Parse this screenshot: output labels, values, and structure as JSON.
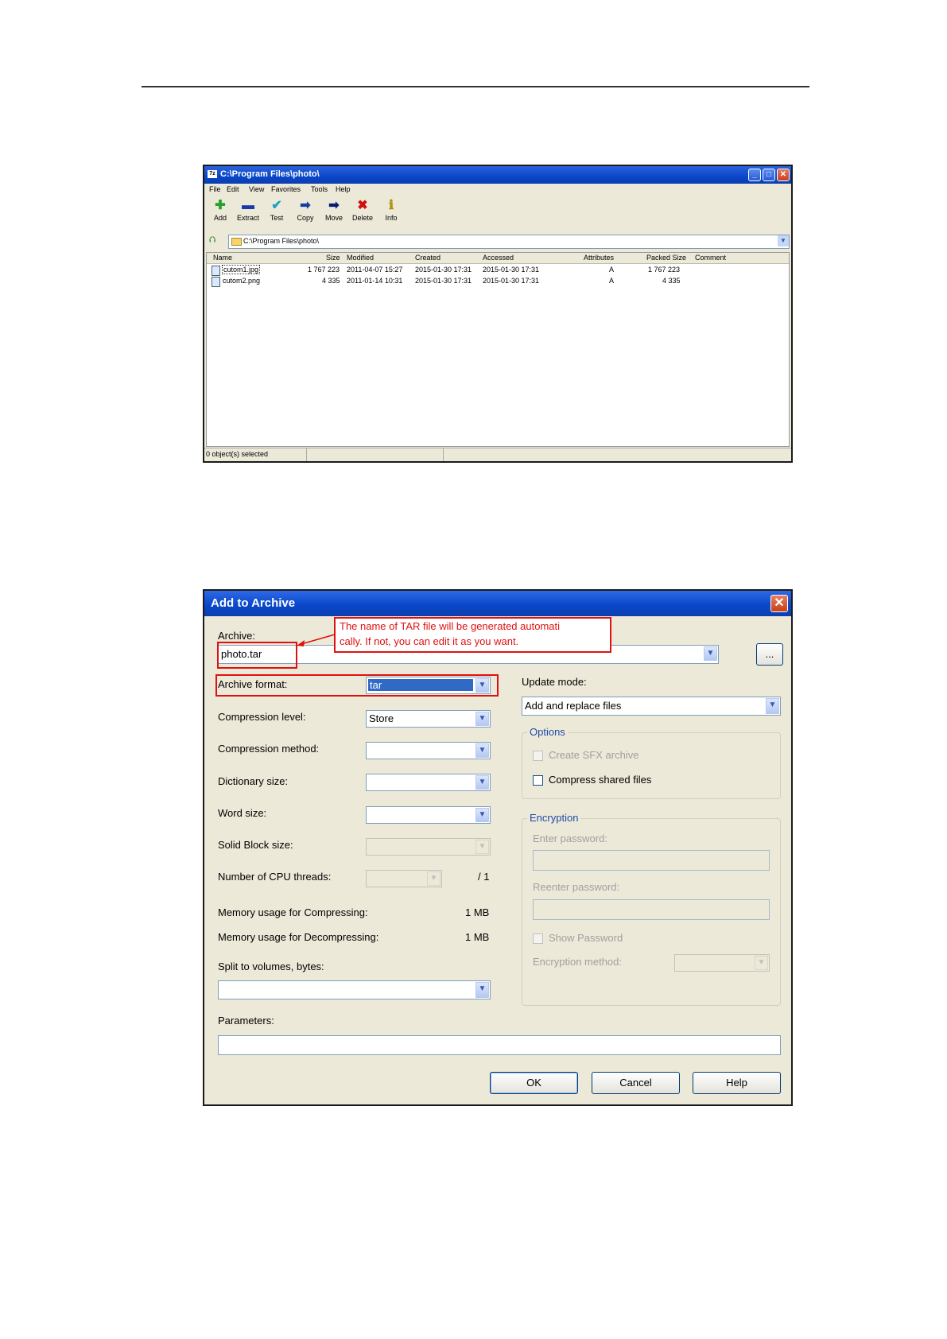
{
  "file_manager": {
    "title": "C:\\Program Files\\photo\\",
    "title_icon": "7z",
    "menu": [
      "File",
      "Edit",
      "View",
      "Favorites",
      "Tools",
      "Help"
    ],
    "toolbar": [
      {
        "label": "Add",
        "icon": "plus-icon",
        "glyph": "✚",
        "color": "#2aa02a"
      },
      {
        "label": "Extract",
        "icon": "minus-icon",
        "glyph": "▬",
        "color": "#1a3aa8"
      },
      {
        "label": "Test",
        "icon": "check-icon",
        "glyph": "✔",
        "color": "#18a0c8"
      },
      {
        "label": "Copy",
        "icon": "copy-arrow-icon",
        "glyph": "➡",
        "color": "#1a3aa8"
      },
      {
        "label": "Move",
        "icon": "move-arrow-icon",
        "glyph": "➡",
        "color": "#0a1a78"
      },
      {
        "label": "Delete",
        "icon": "delete-x-icon",
        "glyph": "✖",
        "color": "#d01010"
      },
      {
        "label": "Info",
        "icon": "info-icon",
        "glyph": "ℹ",
        "color": "#b09010"
      }
    ],
    "address": "C:\\Program Files\\photo\\",
    "columns": [
      "Name",
      "Size",
      "Modified",
      "Created",
      "Accessed",
      "Attributes",
      "Packed Size",
      "Comment"
    ],
    "files": [
      {
        "name": "cutom1.jpg",
        "size": "1 767 223",
        "modified": "2011-04-07 15:27",
        "created": "2015-01-30 17:31",
        "accessed": "2015-01-30 17:31",
        "attributes": "A",
        "packed": "1 767 223",
        "comment": ""
      },
      {
        "name": "cutom2.png",
        "size": "4 335",
        "modified": "2011-01-14 10:31",
        "created": "2015-01-30 17:31",
        "accessed": "2015-01-30 17:31",
        "attributes": "A",
        "packed": "4 335",
        "comment": ""
      }
    ],
    "status": "0 object(s) selected"
  },
  "dialog": {
    "title": "Add to Archive",
    "archive_label": "Archive:",
    "archive_value": "photo.tar",
    "browse_label": "...",
    "annotation": [
      "The name of TAR file will be generated automati",
      "cally. If not, you can edit it as you want."
    ],
    "left": {
      "archive_format_label": "Archive format:",
      "archive_format_value": "tar",
      "compression_level_label": "Compression level:",
      "compression_level_value": "Store",
      "compression_method_label": "Compression method:",
      "dictionary_size_label": "Dictionary size:",
      "word_size_label": "Word size:",
      "solid_block_label": "Solid Block size:",
      "cpu_threads_label": "Number of CPU threads:",
      "cpu_threads_max": "/ 1",
      "mem_compress_label": "Memory usage for Compressing:",
      "mem_compress_value": "1 MB",
      "mem_decompress_label": "Memory usage for Decompressing:",
      "mem_decompress_value": "1 MB",
      "split_label": "Split to volumes, bytes:"
    },
    "right": {
      "update_mode_label": "Update mode:",
      "update_mode_value": "Add and replace files",
      "options_title": "Options",
      "create_sfx_label": "Create SFX archive",
      "compress_shared_label": "Compress shared files",
      "encryption_title": "Encryption",
      "enter_password_label": "Enter password:",
      "reenter_password_label": "Reenter password:",
      "show_password_label": "Show Password",
      "encryption_method_label": "Encryption method:"
    },
    "parameters_label": "Parameters:",
    "buttons": {
      "ok": "OK",
      "cancel": "Cancel",
      "help": "Help"
    }
  },
  "colors": {
    "title_bar": "#0a48cc",
    "annotation_red": "#e01010",
    "selection_blue": "#316ac5"
  }
}
